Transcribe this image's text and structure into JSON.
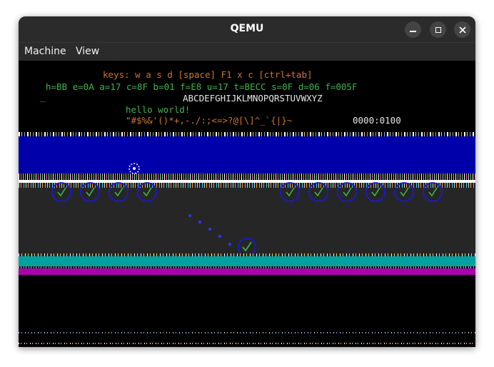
{
  "window": {
    "title": "QEMU",
    "menu": [
      "Machine",
      "View"
    ],
    "controls": {
      "minimize": "minimize-icon",
      "maximize": "maximize-icon",
      "close": "close-icon"
    }
  },
  "screen": {
    "keys_line": "keys: w a s d [space] F1 x c [ctrl+tab]",
    "registers_line": "h=BB e=0A a=17 c=8F b=01 f=E8 u=17 t=BECC s=0F d=06 f=005F",
    "cursor": "_",
    "alphabet_line": "ABCDEFGHIJKLMNOPQRSTUVWXYZ",
    "hello_line": "hello world!",
    "symbols_line": "\"#$%&'()*+,-./:;<=>?@[\\]^_`{|}~",
    "address": "0000:0100"
  },
  "colors": {
    "keys": "#c8762e",
    "registers": "#3cb44a",
    "alphabet": "#e8e8e8",
    "hello": "#3cb44a",
    "symbols": "#c8762e",
    "address": "#e8e8e8",
    "blue_band": "#0000aa",
    "cyan_band": "#00a0a0",
    "magenta_band": "#aa00aa",
    "ring": "#1a1acc"
  }
}
